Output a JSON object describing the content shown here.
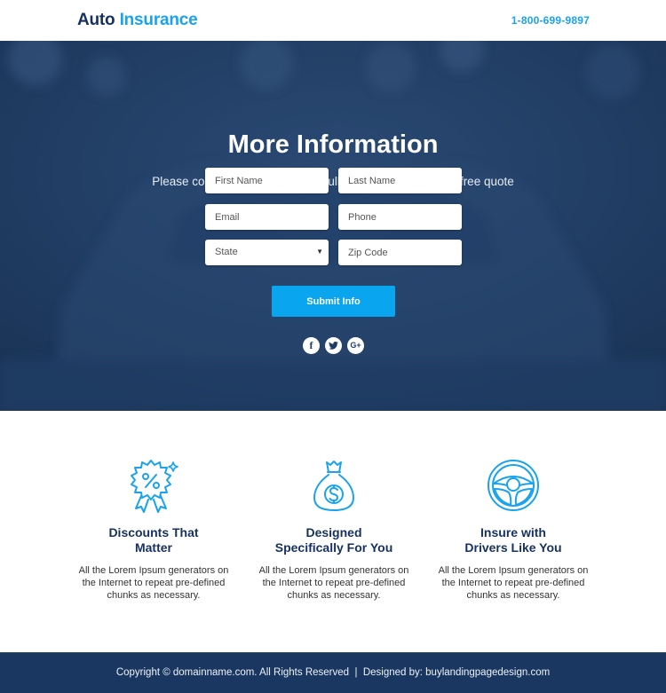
{
  "header": {
    "logo_part1": "Auto",
    "logo_part2": "Insurance",
    "phone": "1-800-699-9897"
  },
  "hero": {
    "title": "More Information",
    "subtitle": "Please complete the form to get full information about our free quote",
    "form": {
      "first_name_placeholder": "First Name",
      "last_name_placeholder": "Last Name",
      "email_placeholder": "Email",
      "phone_placeholder": "Phone",
      "state_selected": "State",
      "zip_placeholder": "Zip Code",
      "submit_label": "Submit Info"
    },
    "social": [
      {
        "name": "facebook",
        "glyph": "f"
      },
      {
        "name": "twitter",
        "glyph": ""
      },
      {
        "name": "google-plus",
        "glyph": "G+"
      }
    ]
  },
  "features": [
    {
      "icon": "discount-badge-icon",
      "title_line1": "Discounts That",
      "title_line2": "Matter",
      "text": "All the Lorem Ipsum generators on the Internet to repeat pre-defined chunks as necessary."
    },
    {
      "icon": "money-bag-icon",
      "title_line1": "Designed",
      "title_line2": "Specifically For You",
      "text": "All the Lorem Ipsum generators on the Internet to repeat pre-defined chunks as necessary."
    },
    {
      "icon": "steering-wheel-icon",
      "title_line1": "Insure with",
      "title_line2": "Drivers Like You",
      "text": "All the Lorem Ipsum generators on the Internet to repeat pre-defined chunks as necessary."
    }
  ],
  "footer": {
    "copyright": "Copyright © domainname.com. All Rights Reserved",
    "separator": "|",
    "designed_by_label": "Designed by:",
    "designed_by_link": "buylandingpagedesign.com"
  },
  "colors": {
    "brand_dark": "#16315f",
    "brand_accent": "#1aa3ec",
    "button": "#0aa5ef",
    "hero_bg": "#1f3c63",
    "footer_bg": "#1a3761"
  }
}
